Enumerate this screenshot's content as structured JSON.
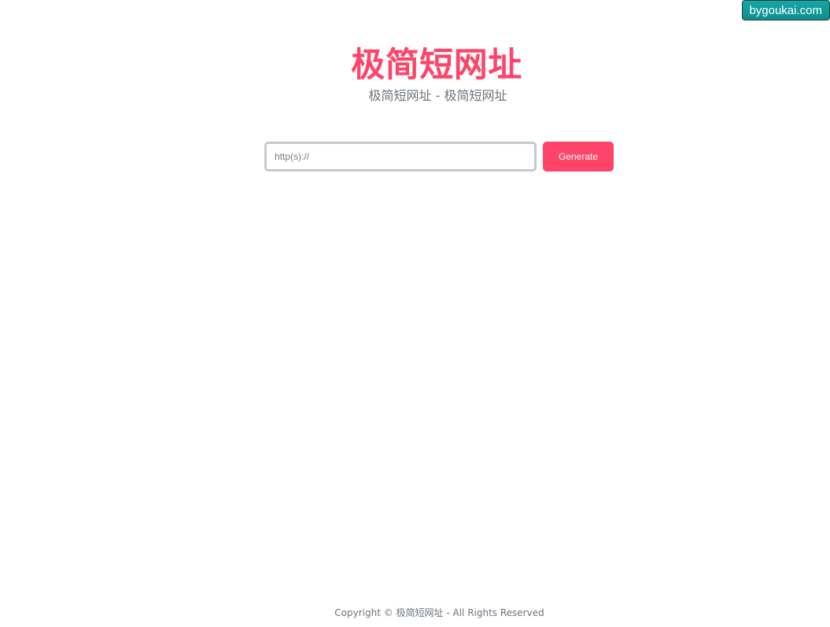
{
  "badge": {
    "label": "bygoukai.com"
  },
  "header": {
    "title": "极简短网址",
    "subtitle": "极简短网址 - 极简短网址"
  },
  "form": {
    "url_placeholder": "http(s)://",
    "url_value": "",
    "generate_label": "Generate"
  },
  "footer": {
    "copyright": "Copyright © 极简短网址 - All Rights Reserved"
  },
  "colors": {
    "accent": "#ff4469",
    "badge_bg": "#0c8f8e",
    "muted_text": "#6c757d",
    "input_border": "#c6c9cc"
  }
}
